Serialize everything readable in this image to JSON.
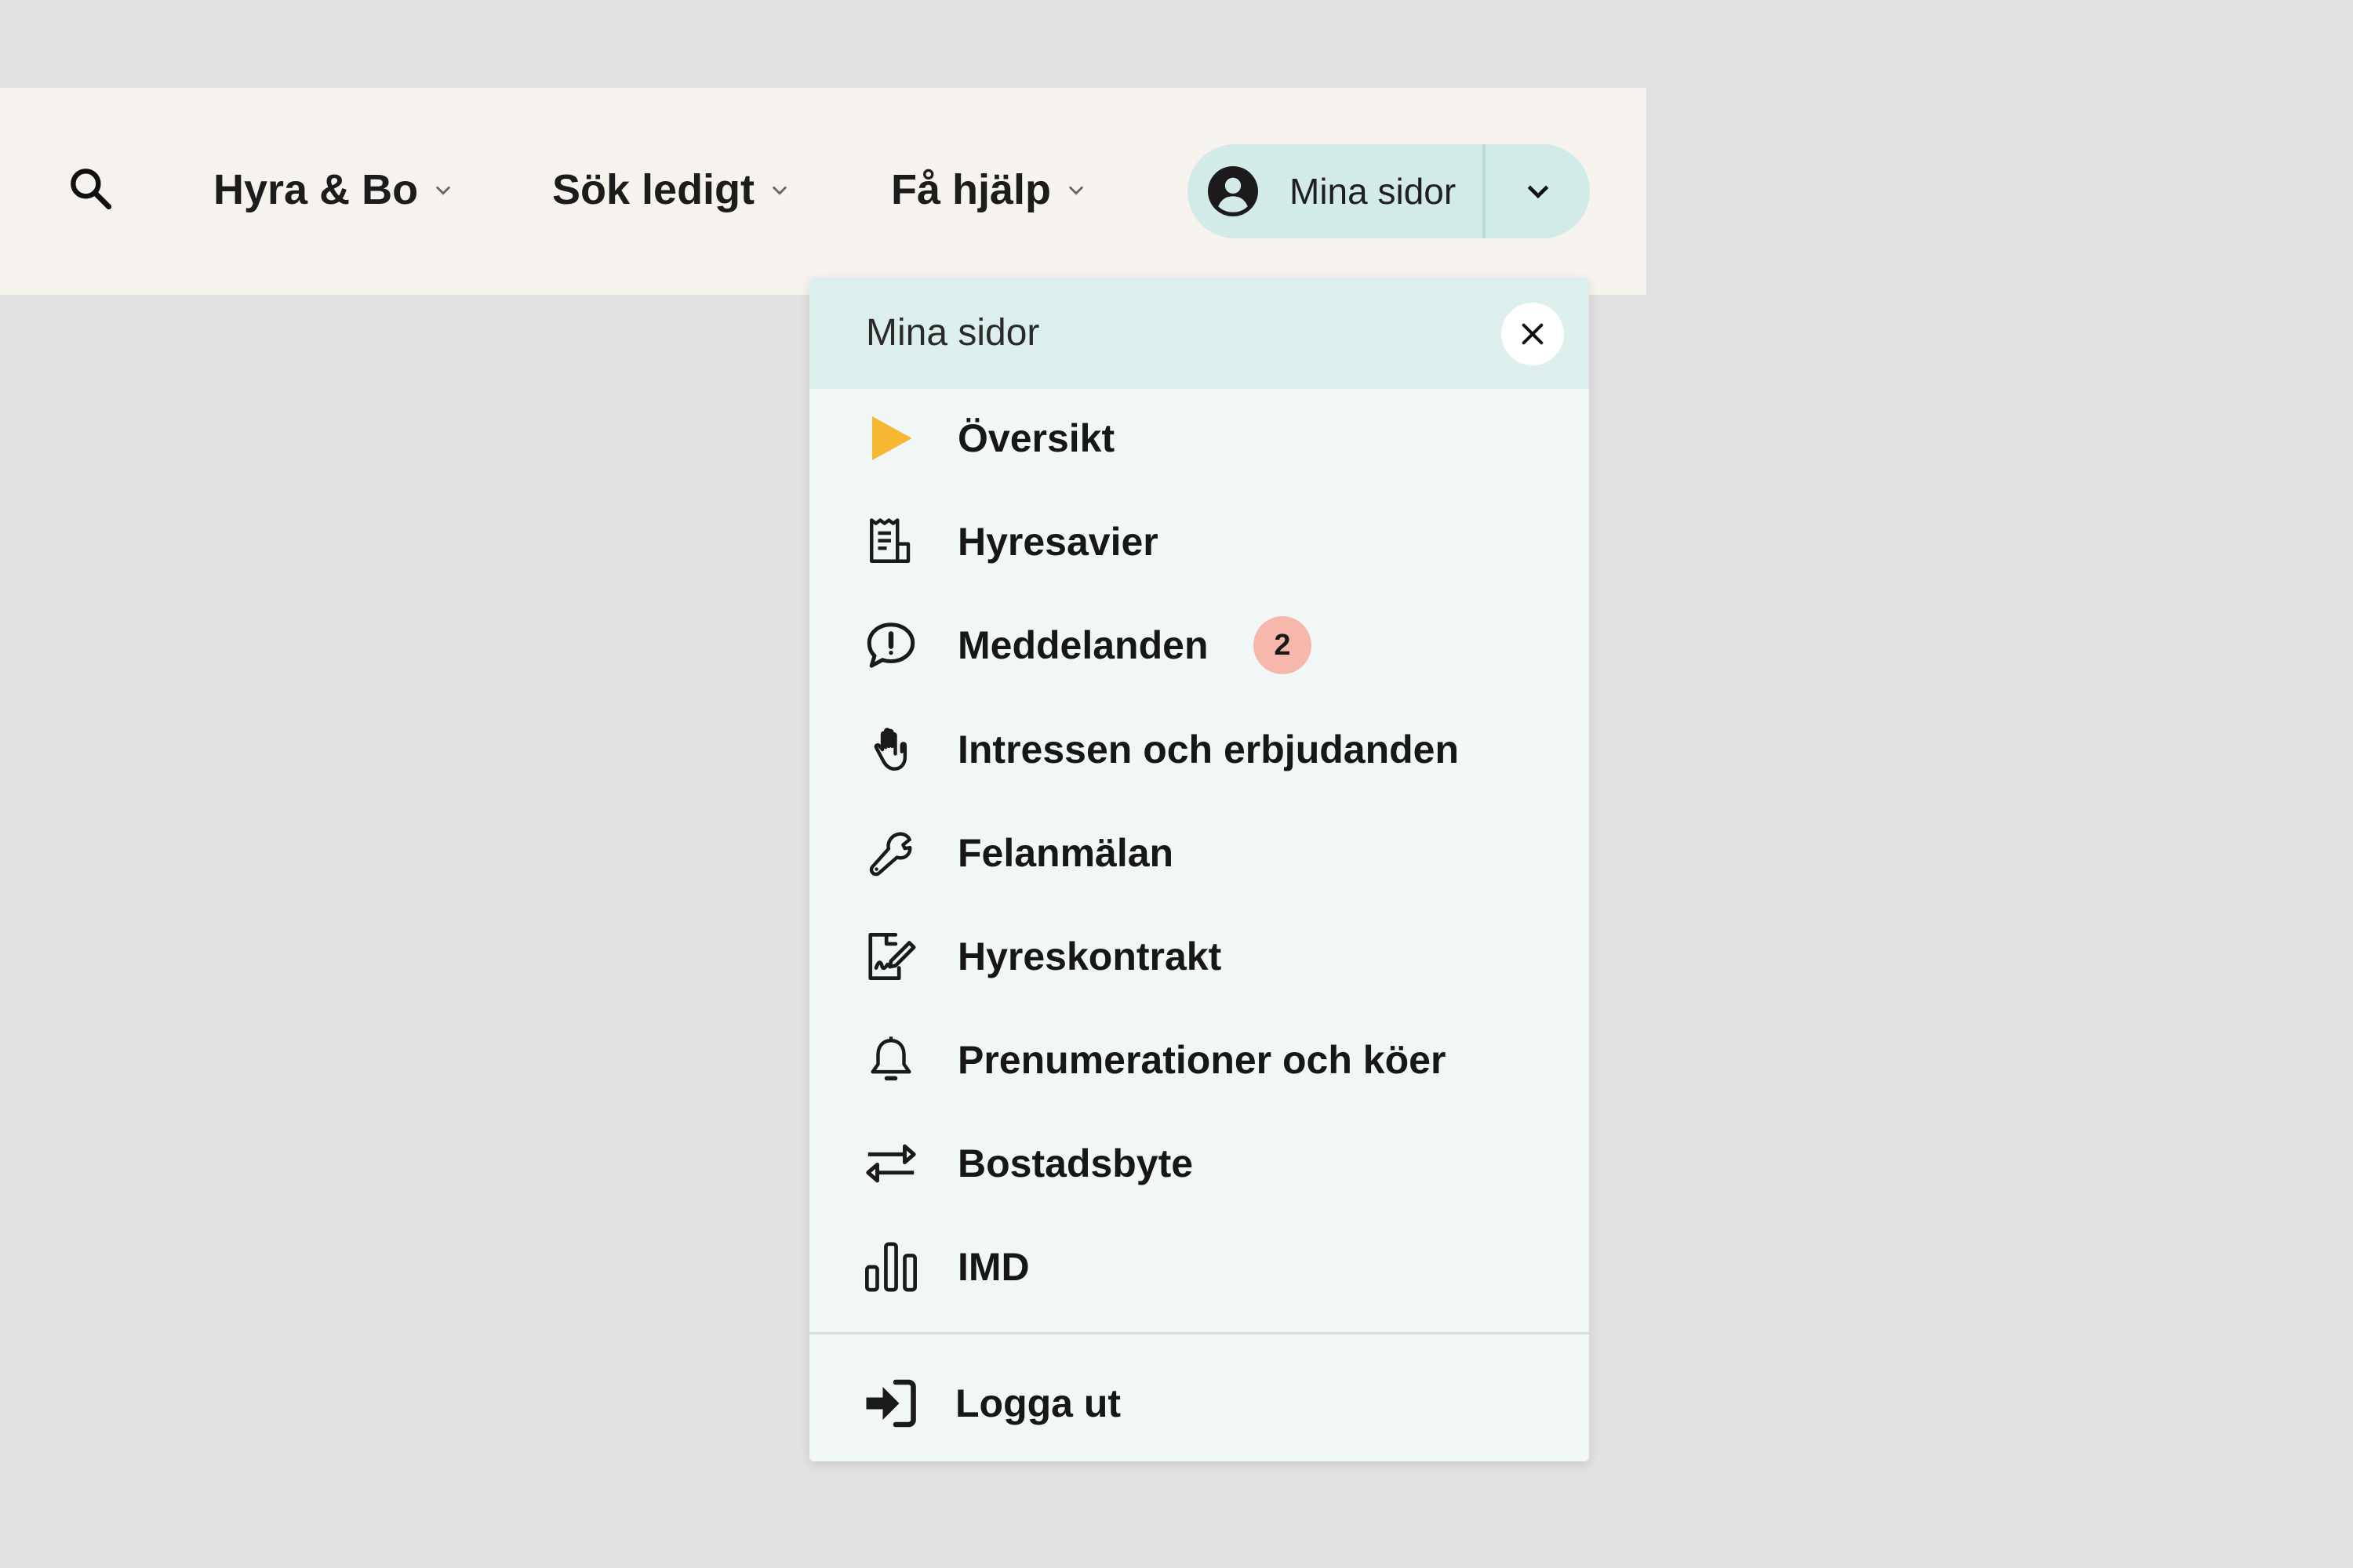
{
  "header": {
    "nav": [
      {
        "label": "Hyra & Bo"
      },
      {
        "label": "Sök ledigt"
      },
      {
        "label": "Få hjälp"
      }
    ],
    "account": {
      "label": "Mina sidor"
    }
  },
  "menu": {
    "title": "Mina sidor",
    "items": [
      {
        "label": "Översikt",
        "icon": "play-triangle-icon"
      },
      {
        "label": "Hyresavier",
        "icon": "invoice-icon"
      },
      {
        "label": "Meddelanden",
        "icon": "message-alert-icon",
        "badge": "2"
      },
      {
        "label": "Intressen och erbjudanden",
        "icon": "hand-icon"
      },
      {
        "label": "Felanmälan",
        "icon": "wrench-icon"
      },
      {
        "label": "Hyreskontrakt",
        "icon": "contract-sign-icon"
      },
      {
        "label": "Prenumerationer och köer",
        "icon": "bell-icon"
      },
      {
        "label": "Bostadsbyte",
        "icon": "swap-arrows-icon"
      },
      {
        "label": "IMD",
        "icon": "bar-chart-icon"
      }
    ],
    "logout": {
      "label": "Logga ut",
      "icon": "logout-icon"
    }
  },
  "colors": {
    "page_bg": "#e1e1e1",
    "header_bg": "#f6f3ef",
    "account_pill": "#d3ebe8",
    "panel_bg": "#f1f7f6",
    "panel_head": "#ddefec",
    "accent_active": "#f7b733",
    "badge_bg": "#f7b7ad"
  }
}
